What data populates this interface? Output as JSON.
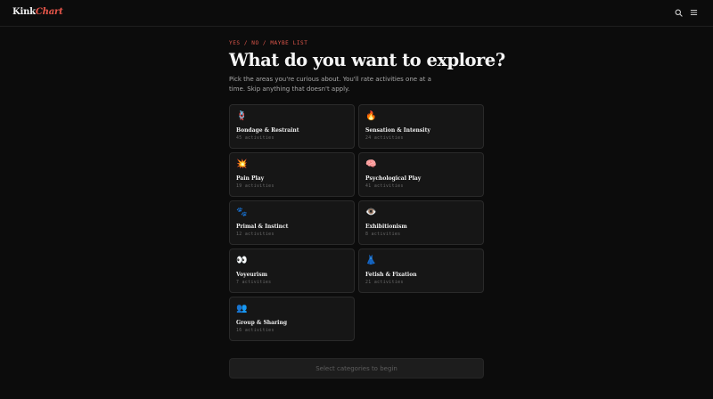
{
  "header": {
    "logo_part1": "Kink",
    "logo_part2": "Chart"
  },
  "intro": {
    "eyebrow": "YES / NO / MAYBE LIST",
    "title": "What do you want to explore?",
    "subtitle": "Pick the areas you're curious about. You'll rate activities one at a time. Skip anything that doesn't apply."
  },
  "categories": [
    {
      "emoji": "🪢",
      "name": "Bondage & Restraint",
      "count": "45 activities"
    },
    {
      "emoji": "🔥",
      "name": "Sensation & Intensity",
      "count": "24 activities"
    },
    {
      "emoji": "💥",
      "name": "Pain Play",
      "count": "19 activities"
    },
    {
      "emoji": "🧠",
      "name": "Psychological Play",
      "count": "41 activities"
    },
    {
      "emoji": "🐾",
      "name": "Primal & Instinct",
      "count": "12 activities"
    },
    {
      "emoji": "👁️",
      "name": "Exhibitionism",
      "count": "8 activities"
    },
    {
      "emoji": "👀",
      "name": "Voyeurism",
      "count": "7 activities"
    },
    {
      "emoji": "👗",
      "name": "Fetish & Fixation",
      "count": "21 activities"
    },
    {
      "emoji": "👥",
      "name": "Group & Sharing",
      "count": "16 activities"
    }
  ],
  "cta": {
    "label": "Select categories to begin"
  },
  "icons": {
    "top_right": [
      "search-icon",
      "menu-icon"
    ]
  },
  "colors": {
    "accent": "#e0574b",
    "background": "#0c0c0c",
    "card": "#161616"
  }
}
